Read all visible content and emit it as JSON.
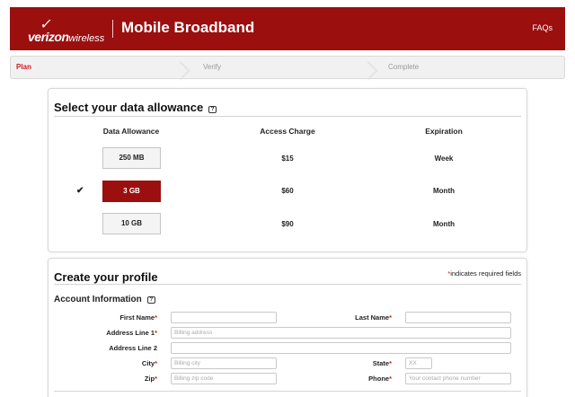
{
  "header": {
    "logo_main": "verizon",
    "logo_sub": "wireless",
    "title": "Mobile Broadband",
    "faqs_label": "FAQs",
    "bg_color": "#9b0f0f"
  },
  "steps": [
    {
      "label": "Plan",
      "active": true
    },
    {
      "label": "Verify",
      "active": false
    },
    {
      "label": "Complete",
      "active": false
    }
  ],
  "allowance": {
    "title": "Select your data allowance",
    "help_icon": "help-icon",
    "headers": {
      "allowance": "Data Allowance",
      "charge": "Access Charge",
      "expiration": "Expiration"
    },
    "plans": [
      {
        "label": "250 MB",
        "charge": "$15",
        "expiration": "Week",
        "selected": false
      },
      {
        "label": "3 GB",
        "charge": "$60",
        "expiration": "Month",
        "selected": true
      },
      {
        "label": "10 GB",
        "charge": "$90",
        "expiration": "Month",
        "selected": false
      }
    ],
    "check_glyph": "✔"
  },
  "profile": {
    "title": "Create your profile",
    "required_asterisk": "*",
    "required_note": "indicates required fields",
    "account_info": "Account Information",
    "fields": {
      "first_name": {
        "label": "First Name",
        "required": true,
        "value": "",
        "placeholder": ""
      },
      "last_name": {
        "label": "Last Name",
        "required": true,
        "value": "",
        "placeholder": ""
      },
      "address1": {
        "label": "Address Line 1",
        "required": true,
        "value": "",
        "placeholder": "Billing address"
      },
      "address2": {
        "label": "Address Line 2",
        "required": false,
        "value": "",
        "placeholder": ""
      },
      "city": {
        "label": "City",
        "required": true,
        "value": "",
        "placeholder": "Billing city"
      },
      "state": {
        "label": "State",
        "required": true,
        "value": "",
        "placeholder": "XX"
      },
      "zip": {
        "label": "Zip",
        "required": true,
        "value": "",
        "placeholder": "Billing zip code"
      },
      "phone": {
        "label": "Phone",
        "required": true,
        "value": "",
        "placeholder": "Your contact phone number"
      }
    }
  }
}
